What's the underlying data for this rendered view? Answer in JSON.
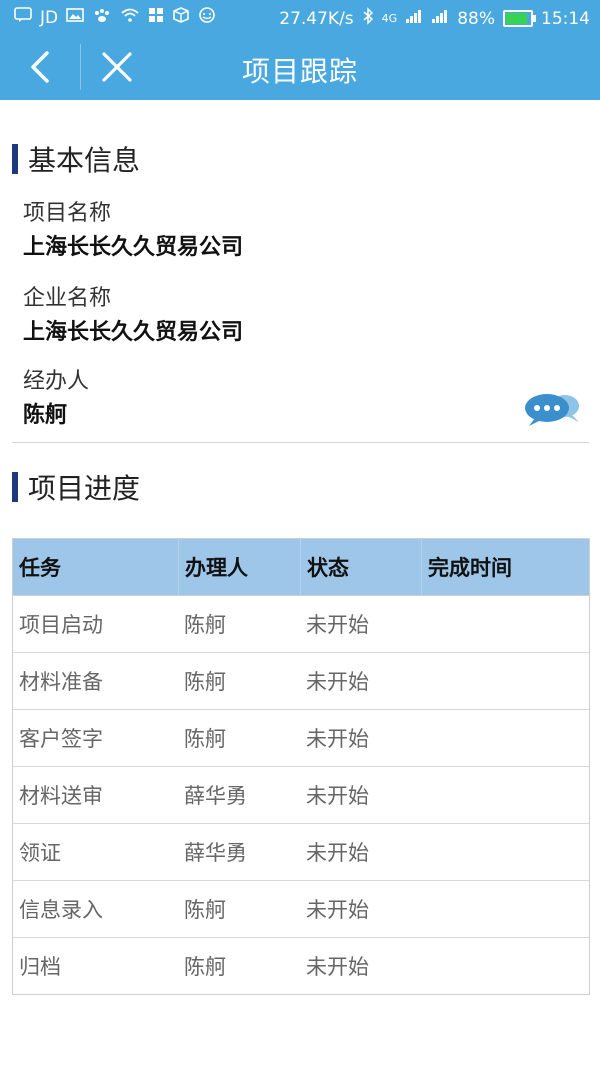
{
  "status_bar": {
    "carrier_icons": [
      "message-icon",
      "jd-app",
      "image-icon",
      "paw-icon",
      "wifi-icon",
      "grid-icon",
      "box-icon",
      "face-icon"
    ],
    "jd_label": "JD",
    "net_speed": "27.47K/s",
    "network_type": "4G",
    "battery_percent": "88%",
    "battery_level": 0.88,
    "time": "15:14"
  },
  "nav": {
    "title": "项目跟踪"
  },
  "basic_info": {
    "section_title": "基本信息",
    "project_name_label": "项目名称",
    "project_name_value": "上海长长久久贸易公司",
    "company_name_label": "企业名称",
    "company_name_value": "上海长长久久贸易公司",
    "handler_label": "经办人",
    "handler_value": "陈舸"
  },
  "progress": {
    "section_title": "项目进度",
    "columns": [
      "任务",
      "办理人",
      "状态",
      "完成时间"
    ],
    "rows": [
      {
        "task": "项目启动",
        "handler": "陈舸",
        "status": "未开始",
        "done_time": ""
      },
      {
        "task": "材料准备",
        "handler": "陈舸",
        "status": "未开始",
        "done_time": ""
      },
      {
        "task": "客户签字",
        "handler": "陈舸",
        "status": "未开始",
        "done_time": ""
      },
      {
        "task": "材料送审",
        "handler": "薛华勇",
        "status": "未开始",
        "done_time": ""
      },
      {
        "task": "领证",
        "handler": "薛华勇",
        "status": "未开始",
        "done_time": ""
      },
      {
        "task": "信息录入",
        "handler": "陈舸",
        "status": "未开始",
        "done_time": ""
      },
      {
        "task": "归档",
        "handler": "陈舸",
        "status": "未开始",
        "done_time": ""
      }
    ]
  },
  "colors": {
    "topbar": "#4aa8e0",
    "accent_bar": "#1f3a7a",
    "table_header": "#9dc6e9",
    "chat_icon": "#3b8fcc"
  }
}
